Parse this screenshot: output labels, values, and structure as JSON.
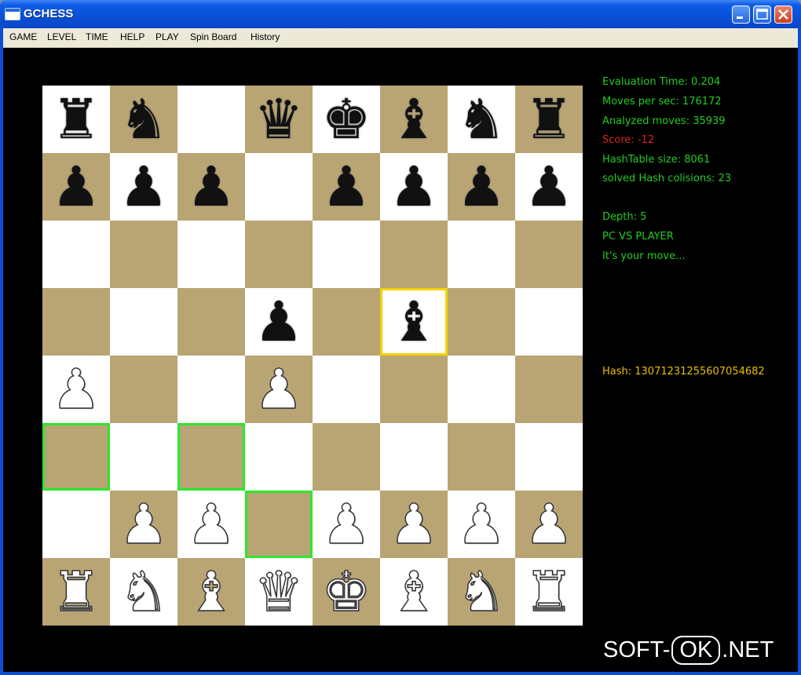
{
  "window": {
    "title": "GCHESS"
  },
  "menu": [
    "GAME",
    "LEVEL",
    "TIME",
    "HELP",
    "PLAY",
    "Spin Board",
    "History"
  ],
  "colors": {
    "light_square": "#ffffff",
    "dark_square": "#b9a574",
    "selected_highlight": "#f3d200",
    "move_highlight": "#2ee62e",
    "info_green": "#22cc22",
    "score_red": "#dd2020",
    "hash_yellow": "#e8c000"
  },
  "board": {
    "ranks": [
      "rn.qkbnr",
      "ppp.pppp",
      "........",
      "...p.b..",
      "P..P....",
      "........",
      ".PP.PPPP",
      "RNBQKBNR"
    ],
    "selected": "f5",
    "move_targets": [
      "a3",
      "c3",
      "d2"
    ]
  },
  "info": {
    "eval_time": "Evaluation Time: 0.204",
    "moves_per_sec": "Moves per sec: 176172",
    "analyzed_moves": "Analyzed moves: 35939",
    "score": "Score: -12",
    "hashtable_size": "HashTable size: 8061",
    "hash_collisions": "solved Hash colisions: 23",
    "depth": "Depth: 5",
    "mode": "PC VS PLAYER",
    "status": "It's your move...",
    "hash": "Hash: 13071231255607054682"
  },
  "watermark": {
    "left": "SOFT-",
    "mid": "OK",
    "right": ".NET"
  }
}
